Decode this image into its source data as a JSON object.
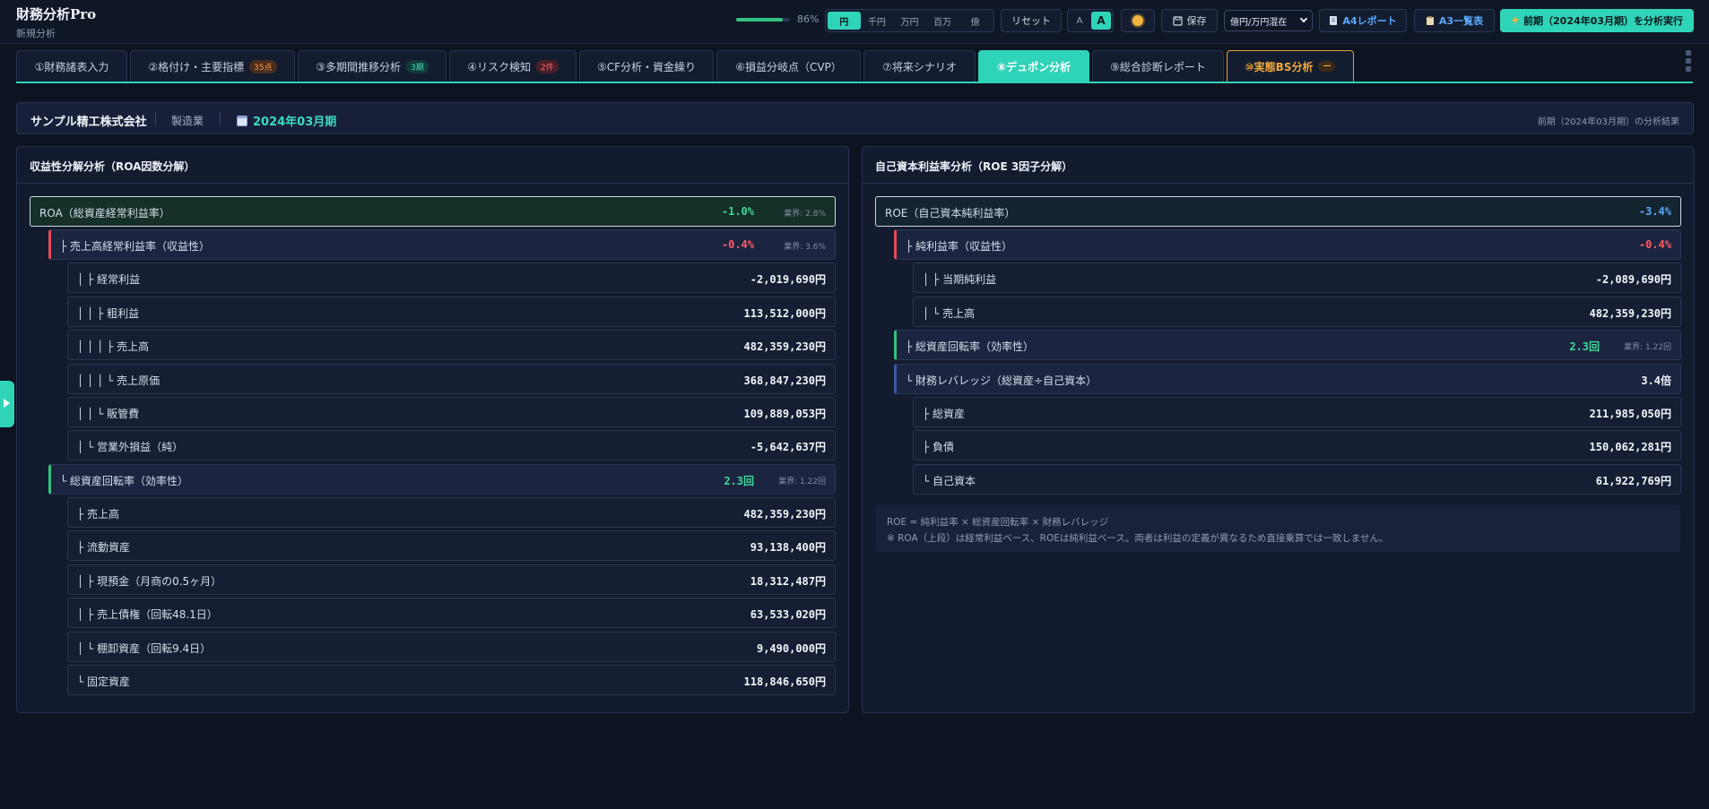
{
  "app": {
    "title": "財務分析Pro",
    "subtitle": "新規分析"
  },
  "progress": {
    "value": 0.86,
    "label": "86%"
  },
  "units": [
    {
      "label": "円",
      "active": true
    },
    {
      "label": "千円",
      "active": false
    },
    {
      "label": "万円",
      "active": false
    },
    {
      "label": "百万",
      "active": false
    },
    {
      "label": "億",
      "active": false
    }
  ],
  "toolbar": {
    "reset": "リセット",
    "font_small": "A",
    "font_large": "A",
    "save": "保存",
    "select_value": "億円/万円混在",
    "a4_report": "A4レポート",
    "a3_list": "A3一覧表",
    "run": "前期（2024年03月期）を分析実行"
  },
  "tabs": [
    {
      "label": "①財務諸表入力"
    },
    {
      "label": "②格付け・主要指標",
      "badge": "35点"
    },
    {
      "label": "③多期間推移分析",
      "badge": "3期"
    },
    {
      "label": "④リスク検知",
      "badge": "2件"
    },
    {
      "label": "⑤CF分析・資金繰り"
    },
    {
      "label": "⑥損益分岐点（CVP）"
    },
    {
      "label": "⑦将来シナリオ"
    },
    {
      "label": "⑧デュポン分析"
    },
    {
      "label": "⑨総合診断レポート"
    },
    {
      "label": "⑩実態BS分析",
      "badge": "—"
    }
  ],
  "company": {
    "name": "サンプル精工株式会社",
    "industry": "製造業",
    "period": "2024年03月期",
    "result_label": "前期（2024年03月期）の分析結果"
  },
  "left": {
    "title": "収益性分解分析（ROA因数分解）",
    "rows": [
      {
        "label": "ROA（総資産経常利益率）",
        "value": "-1.0%",
        "bench": "業界: 2.8%"
      },
      {
        "label": "├ 売上高経常利益率（収益性）",
        "value": "-0.4%",
        "bench": "業界: 3.6%"
      },
      {
        "label": "│ ├ 経常利益",
        "value": "-2,019,690円"
      },
      {
        "label": "│ │ ├ 粗利益",
        "value": "113,512,000円"
      },
      {
        "label": "│ │ │ ├ 売上高",
        "value": "482,359,230円"
      },
      {
        "label": "│ │ │ └ 売上原価",
        "value": "368,847,230円"
      },
      {
        "label": "│ │ └ 販管費",
        "value": "109,889,053円"
      },
      {
        "label": "│ └ 営業外損益（純）",
        "value": "-5,642,637円"
      },
      {
        "label": "└ 総資産回転率（効率性）",
        "value": "2.3回",
        "bench": "業界: 1.22回"
      },
      {
        "label": "├ 売上高",
        "value": "482,359,230円"
      },
      {
        "label": "├ 流動資産",
        "value": "93,138,400円"
      },
      {
        "label": "│ ├ 現預金（月商の0.5ヶ月）",
        "value": "18,312,487円"
      },
      {
        "label": "│ ├ 売上債権（回転48.1日）",
        "value": "63,533,020円"
      },
      {
        "label": "│ └ 棚卸資産（回転9.4日）",
        "value": "9,490,000円"
      },
      {
        "label": "└ 固定資産",
        "value": "118,846,650円"
      }
    ]
  },
  "right": {
    "title": "自己資本利益率分析（ROE 3因子分解）",
    "rows": [
      {
        "label": "ROE（自己資本純利益率）",
        "value": "-3.4%"
      },
      {
        "label": "├ 純利益率（収益性）",
        "value": "-0.4%"
      },
      {
        "label": "│ ├ 当期純利益",
        "value": "-2,089,690円"
      },
      {
        "label": "│ └ 売上高",
        "value": "482,359,230円"
      },
      {
        "label": "├ 総資産回転率（効率性）",
        "value": "2.3回",
        "bench": "業界: 1.22回"
      },
      {
        "label": "└ 財務レバレッジ（総資産÷自己資本）",
        "value": "3.4倍"
      },
      {
        "label": "├ 総資産",
        "value": "211,985,050円"
      },
      {
        "label": "├ 負債",
        "value": "150,062,281円"
      },
      {
        "label": "└ 自己資本",
        "value": "61,922,769円"
      }
    ],
    "note_line1": "ROE = 純利益率 × 総資産回転率 × 財務レバレッジ",
    "note_line2": "※ ROA（上段）は経常利益ベース、ROEは純利益ベース。両者は利益の定義が異なるため直接乗算では一致しません。"
  }
}
